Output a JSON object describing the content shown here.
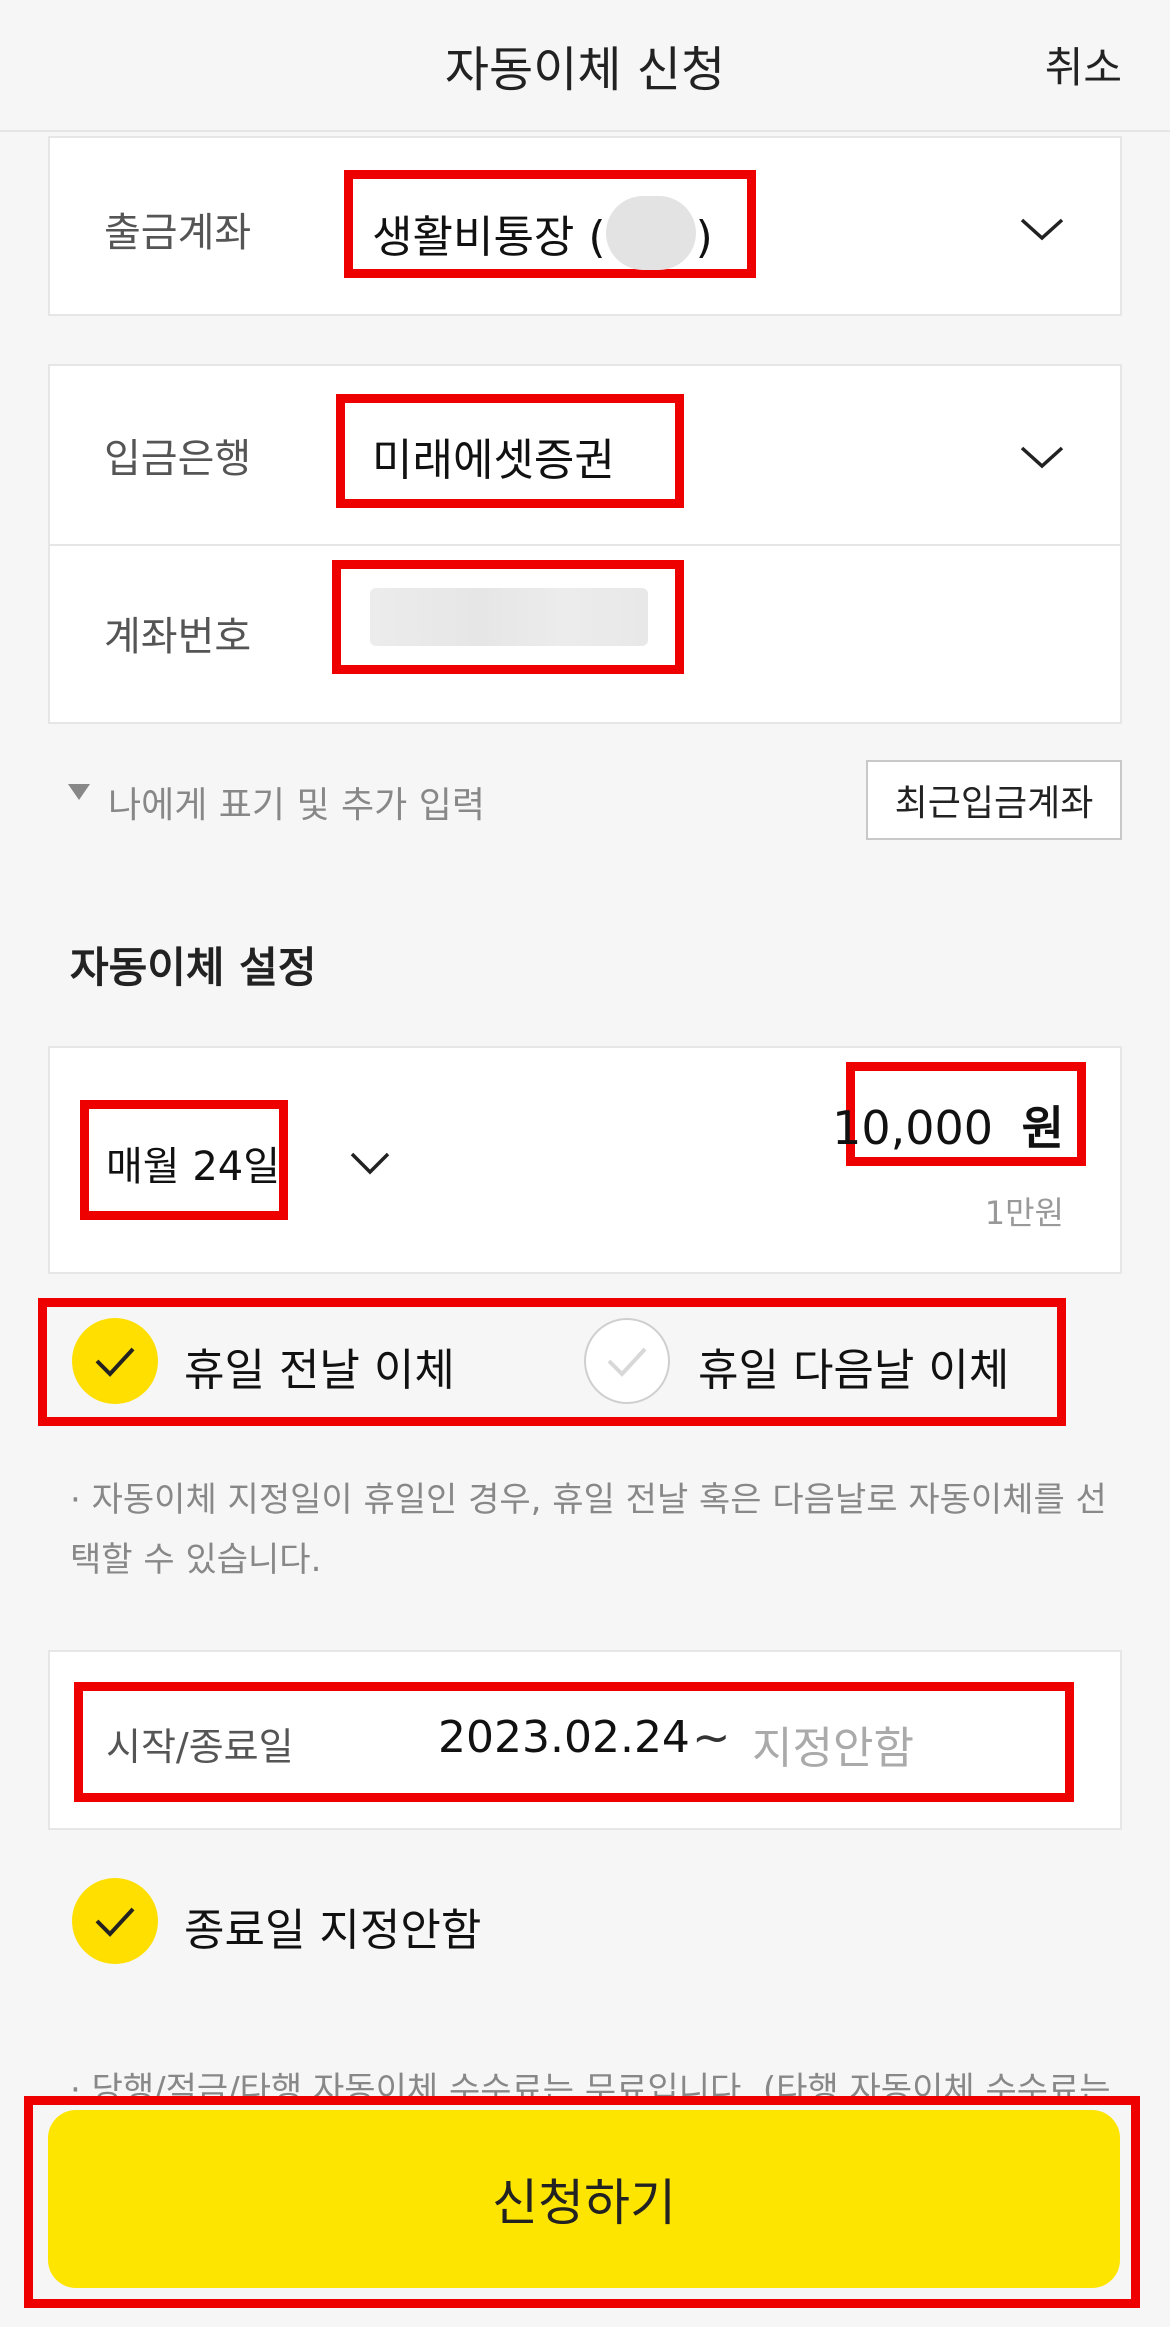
{
  "header": {
    "title": "자동이체 신청",
    "cancel_label": "취소"
  },
  "withdraw": {
    "label": "출금계좌",
    "account_name": "생활비통장 (",
    "account_suffix": ")"
  },
  "deposit": {
    "bank_label": "입금은행",
    "bank_value": "미래에셋증권",
    "account_label": "계좌번호",
    "account_value": ""
  },
  "extra_input_label": "나에게 표기 및 추가 입력",
  "recent_button_label": "최근입금계좌",
  "settings": {
    "section_title": "자동이체 설정",
    "schedule": "매월 24일",
    "amount": "10,000",
    "amount_unit": "원",
    "amount_hint": "1만원"
  },
  "holiday": {
    "prev_label": "휴일 전날 이체",
    "prev_checked": true,
    "next_label": "휴일 다음날 이체",
    "next_checked": false,
    "note": "· 자동이체 지정일이 휴일인 경우, 휴일 전날 혹은 다음날로 자동이체를 선택할 수 있습니다."
  },
  "period": {
    "label": "시작/종료일",
    "start": "2023.02.24",
    "tilde": "~",
    "end_placeholder": "지정안함"
  },
  "no_end": {
    "label": "종료일 지정안함",
    "checked": true
  },
  "fee_note": "· 당행/적금/타행 자동이체 수수료는 무료입니다. (타행 자동이체 수수료는",
  "submit_label": "신청하기",
  "colors": {
    "accent": "#fee500",
    "highlight": "#ee0000",
    "check": "#ffdf00"
  }
}
